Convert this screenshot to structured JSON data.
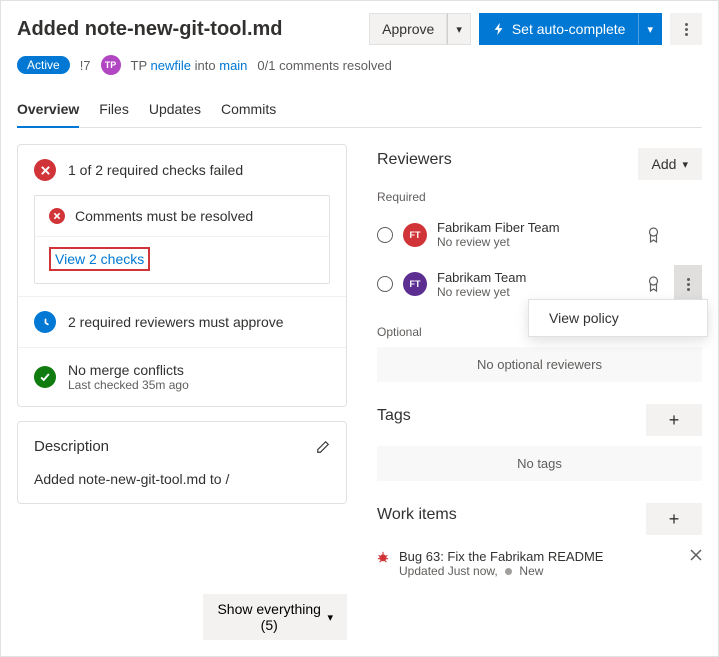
{
  "header": {
    "title": "Added note-new-git-tool.md",
    "approve": "Approve",
    "autocomplete": "Set auto-complete"
  },
  "meta": {
    "status": "Active",
    "prid": "!7",
    "author_initials": "TP",
    "author_name": "TP",
    "source_branch": "newfile",
    "into": "into",
    "target_branch": "main",
    "comments": "0/1 comments resolved"
  },
  "tabs": [
    "Overview",
    "Files",
    "Updates",
    "Commits"
  ],
  "checks": {
    "headline": "1 of 2 required checks failed",
    "comment_msg": "Comments must be resolved",
    "view_link": "View 2 checks",
    "reviewers_msg": "2 required reviewers must approve",
    "merge_msg": "No merge conflicts",
    "merge_sub": "Last checked 35m ago"
  },
  "description": {
    "title": "Description",
    "body": "Added note-new-git-tool.md to /"
  },
  "reviewers": {
    "title": "Reviewers",
    "add": "Add",
    "required": "Required",
    "optional": "Optional",
    "no_optional": "No optional reviewers",
    "items": [
      {
        "initials": "FT",
        "name": "Fabrikam Fiber Team",
        "status": "No review yet",
        "avatar": "av-red"
      },
      {
        "initials": "FT",
        "name": "Fabrikam Team",
        "status": "No review yet",
        "avatar": "av-purple"
      }
    ],
    "popup": "View policy"
  },
  "tags": {
    "title": "Tags",
    "empty": "No tags"
  },
  "workitems": {
    "title": "Work items",
    "item": {
      "title": "Bug 63: Fix the Fabrikam README",
      "updated": "Updated Just now,",
      "state": "New"
    }
  },
  "footer": {
    "show": "Show everything (5)"
  }
}
